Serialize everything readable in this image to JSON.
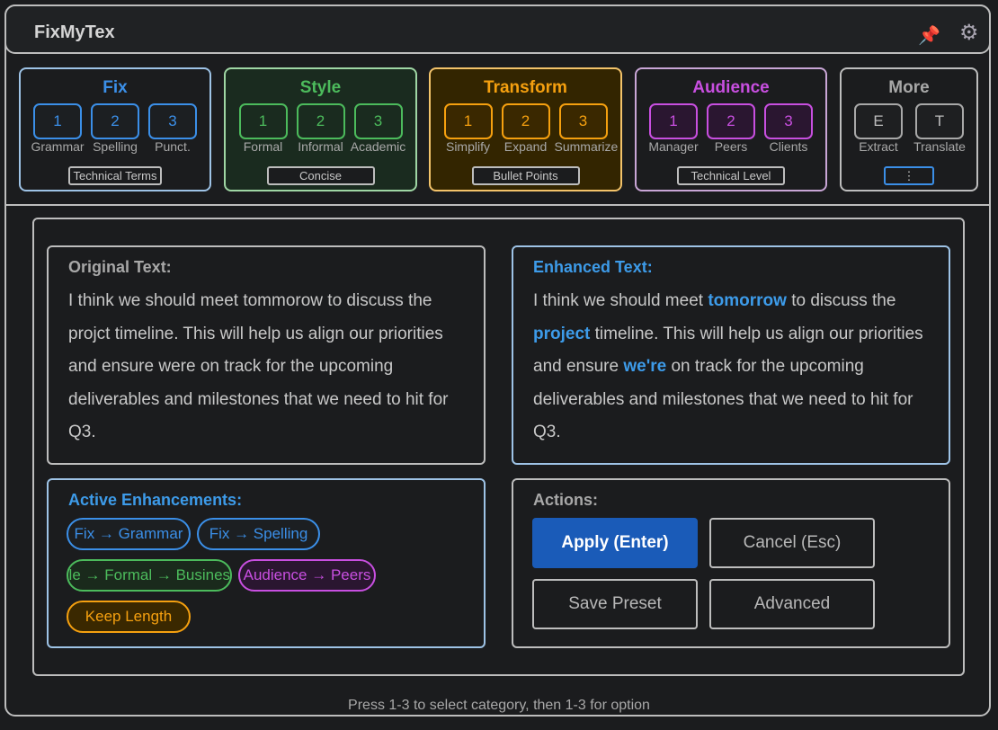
{
  "app": {
    "title": "FixMyTex",
    "pin_icon": "pin-icon",
    "settings_icon": "gear-icon"
  },
  "categories": [
    {
      "name": "Fix",
      "color": "#3b8fe8",
      "keys": [
        "1",
        "2",
        "3"
      ],
      "labels": [
        "Grammar",
        "Spelling",
        "Punct."
      ],
      "extra": "Technical Terms"
    },
    {
      "name": "Style",
      "color": "#4cbb5c",
      "keys": [
        "1",
        "2",
        "3"
      ],
      "labels": [
        "Formal",
        "Informal",
        "Academic"
      ],
      "extra": "Concise"
    },
    {
      "name": "Transform",
      "color": "#f5a00f",
      "keys": [
        "1",
        "2",
        "3"
      ],
      "labels": [
        "Simplify",
        "Expand",
        "Summarize"
      ],
      "extra": "Bullet Points"
    },
    {
      "name": "Audience",
      "color": "#c84fe0",
      "keys": [
        "1",
        "2",
        "3"
      ],
      "labels": [
        "Manager",
        "Peers",
        "Clients"
      ],
      "extra": "Technical Level"
    },
    {
      "name": "More",
      "color": "#a8a8a8",
      "keys": [
        "E",
        "T"
      ],
      "labels": [
        "Extract",
        "Translate"
      ],
      "extra": "⋮"
    }
  ],
  "original": {
    "title": "Original Text:",
    "text": "I think we should meet tommorow to discuss the projct timeline. This will help us align our priorities and ensure were on track for the upcoming deliverables and milestones that we need to hit for Q3."
  },
  "enhanced": {
    "title": "Enhanced Text:",
    "parts": [
      "I think we should meet ",
      "tomorrow",
      " to discuss the ",
      "project",
      " timeline. This will help us align our priorities and ensure ",
      "we're",
      " on track for the upcoming deliverables and milestones that we need to hit for Q3."
    ]
  },
  "active": {
    "title": "Active Enhancements:",
    "chips": [
      "Fix → Grammar",
      "Fix → Spelling",
      "Style → Formal → Business",
      "Audience → Peers",
      "Keep Length"
    ]
  },
  "actions": {
    "title": "Actions:",
    "apply": "Apply (Enter)",
    "cancel": "Cancel (Esc)",
    "save": "Save Preset",
    "advanced": "Advanced"
  },
  "footer": "Press 1-3 to select category, then 1-3 for option"
}
